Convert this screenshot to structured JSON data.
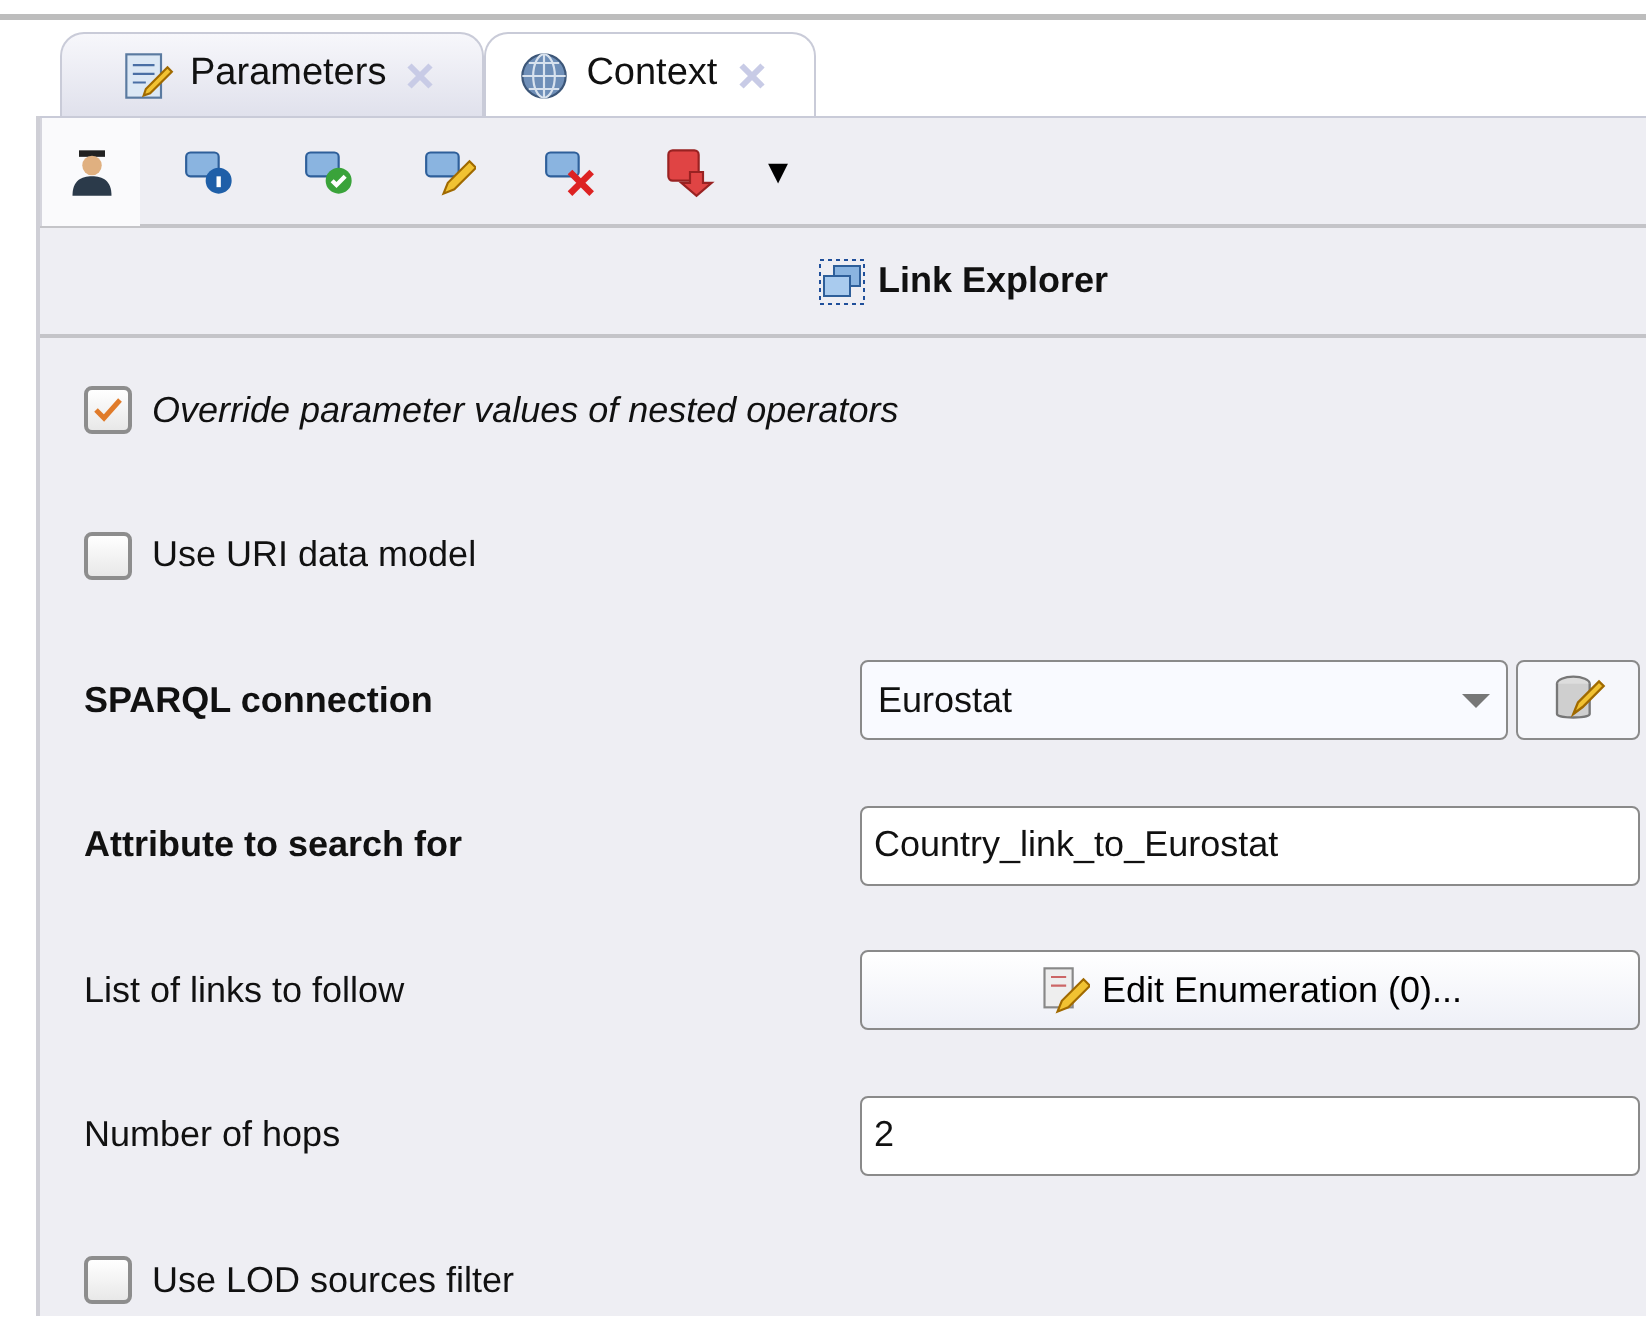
{
  "tabs": [
    {
      "label": "Parameters",
      "selected": false
    },
    {
      "label": "Context",
      "selected": true
    }
  ],
  "toolbar": {
    "items": [
      {
        "selected": true
      },
      {
        "selected": false
      },
      {
        "selected": false
      },
      {
        "selected": false
      },
      {
        "selected": false
      },
      {
        "selected": false
      }
    ],
    "dropdown": "▾"
  },
  "header": {
    "title": "Link Explorer"
  },
  "parameters": [
    {
      "kind": "checkbox",
      "label": "Override parameter values of nested operators",
      "checked": true,
      "italic": true
    },
    {
      "kind": "checkbox",
      "label": "Use URI data model",
      "checked": false,
      "italic": false
    },
    {
      "kind": "select",
      "label": "SPARQL connection",
      "bold": true,
      "value": "Eurostat"
    },
    {
      "kind": "text",
      "label": "Attribute to search for",
      "bold": true,
      "value": "Country_link_to_Eurostat"
    },
    {
      "kind": "button",
      "label": "List of links to follow",
      "bold": false,
      "value": "Edit Enumeration (0)..."
    },
    {
      "kind": "text",
      "label": "Number of hops",
      "bold": false,
      "value": "2"
    },
    {
      "kind": "checkbox",
      "label": "Use LOD sources filter",
      "checked": false,
      "italic": false
    }
  ]
}
